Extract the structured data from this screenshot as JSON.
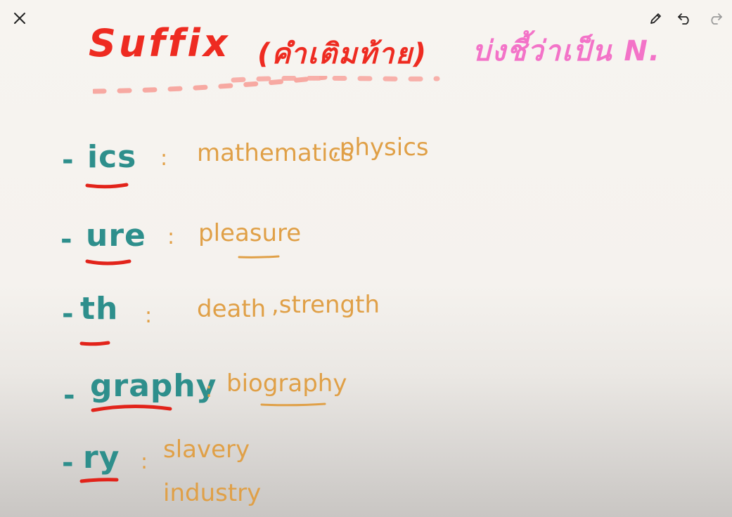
{
  "toolbar": {
    "close_icon": "close-icon",
    "pen_icon": "pencil-icon",
    "undo_icon": "undo-icon",
    "redo_icon": "redo-icon"
  },
  "heading": {
    "title": "Suffix",
    "subtitle": "(คำเติมท้าย)",
    "note": "บ่งชี้ว่าเป็น N."
  },
  "suffixes": [
    {
      "dash": "-",
      "suffix": "ics",
      "colon": ":",
      "examples": [
        "mathematics",
        ",physics"
      ]
    },
    {
      "dash": "-",
      "suffix": "ure",
      "colon": ":",
      "examples": [
        "pleasure"
      ]
    },
    {
      "dash": "-",
      "suffix": "th",
      "colon": ":",
      "examples": [
        "death",
        ",strength"
      ]
    },
    {
      "dash": "-",
      "suffix": "graphy",
      "colon": ":",
      "examples": [
        "biography"
      ]
    },
    {
      "dash": "-",
      "suffix": "ry",
      "colon": ":",
      "examples": [
        "slavery",
        "industry"
      ]
    }
  ],
  "colors": {
    "title": "#ee2b21",
    "note": "#f373c8",
    "suffix": "#2e8f8c",
    "example": "#e0a047",
    "underline_red": "#e2231a",
    "dash_pink": "#f7a9a2"
  }
}
